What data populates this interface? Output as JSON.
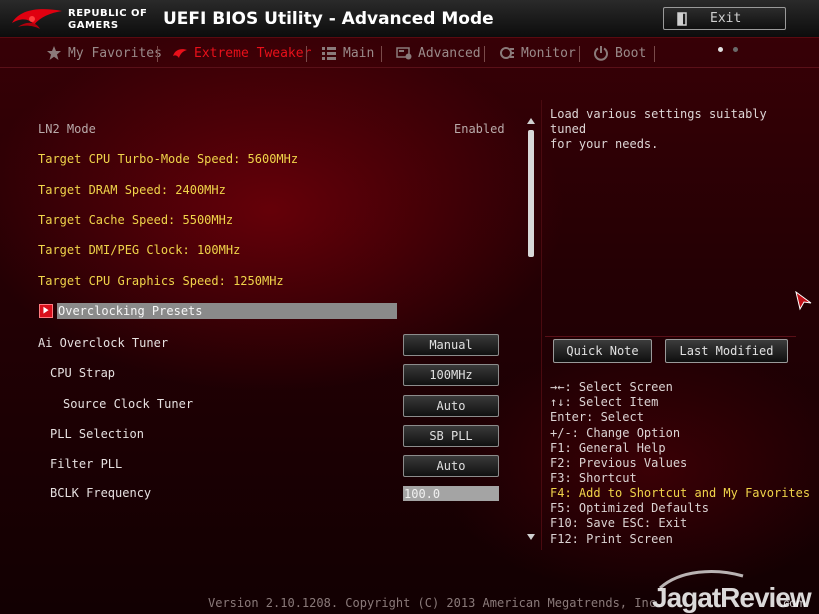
{
  "header": {
    "brand_line1": "REPUBLIC OF",
    "brand_line2": "GAMERS",
    "title": "UEFI BIOS Utility - Advanced Mode",
    "exit_label": "Exit"
  },
  "tabs": [
    {
      "label": "My Favorites",
      "icon": "star-icon",
      "active": false
    },
    {
      "label": "Extreme Tweaker",
      "icon": "tweaker-icon",
      "active": true
    },
    {
      "label": "Main",
      "icon": "list-icon",
      "active": false
    },
    {
      "label": "Advanced",
      "icon": "advanced-icon",
      "active": false
    },
    {
      "label": "Monitor",
      "icon": "monitor-icon",
      "active": false
    },
    {
      "label": "Boot",
      "icon": "power-icon",
      "active": false
    }
  ],
  "settings": {
    "ln2_mode": {
      "label": "LN2 Mode",
      "value": "Enabled"
    },
    "targets": [
      "Target CPU Turbo-Mode Speed: 5600MHz",
      "Target DRAM Speed: 2400MHz",
      "Target Cache Speed: 5500MHz",
      "Target DMI/PEG Clock: 100MHz",
      "Target CPU Graphics Speed: 1250MHz"
    ],
    "overclocking_presets": "Overclocking Presets",
    "ai_overclock_tuner": {
      "label": "Ai Overclock Tuner",
      "value": "Manual"
    },
    "cpu_strap": {
      "label": "CPU Strap",
      "value": "100MHz"
    },
    "source_clock_tuner": {
      "label": "Source Clock Tuner",
      "value": "Auto"
    },
    "pll_selection": {
      "label": "PLL Selection",
      "value": "SB PLL"
    },
    "filter_pll": {
      "label": "Filter PLL",
      "value": "Auto"
    },
    "bclk_frequency": {
      "label": "BCLK Frequency",
      "value": "100.0"
    }
  },
  "help": {
    "description": "Load various settings suitably tuned\nfor your needs.",
    "quick_note": "Quick Note",
    "last_modified": "Last Modified",
    "shortcuts": [
      "→←: Select Screen",
      "↑↓: Select Item",
      "Enter: Select",
      "+/-: Change Option",
      "F1: General Help",
      "F2: Previous Values",
      "F3: Shortcut",
      "F4: Add to Shortcut and My Favorites",
      "F5: Optimized Defaults",
      "F10: Save  ESC: Exit",
      "F12: Print Screen"
    ]
  },
  "footer": {
    "version": "Version 2.10.1208. Copyright (C) 2013 American Megatrends, Inc.",
    "watermark": "JagatReview",
    "watermark_suffix": ".com"
  },
  "colors": {
    "active_tab": "#e8101a",
    "target_text": "#f0d44a",
    "highlight_shortcut": "#f0d44a"
  }
}
